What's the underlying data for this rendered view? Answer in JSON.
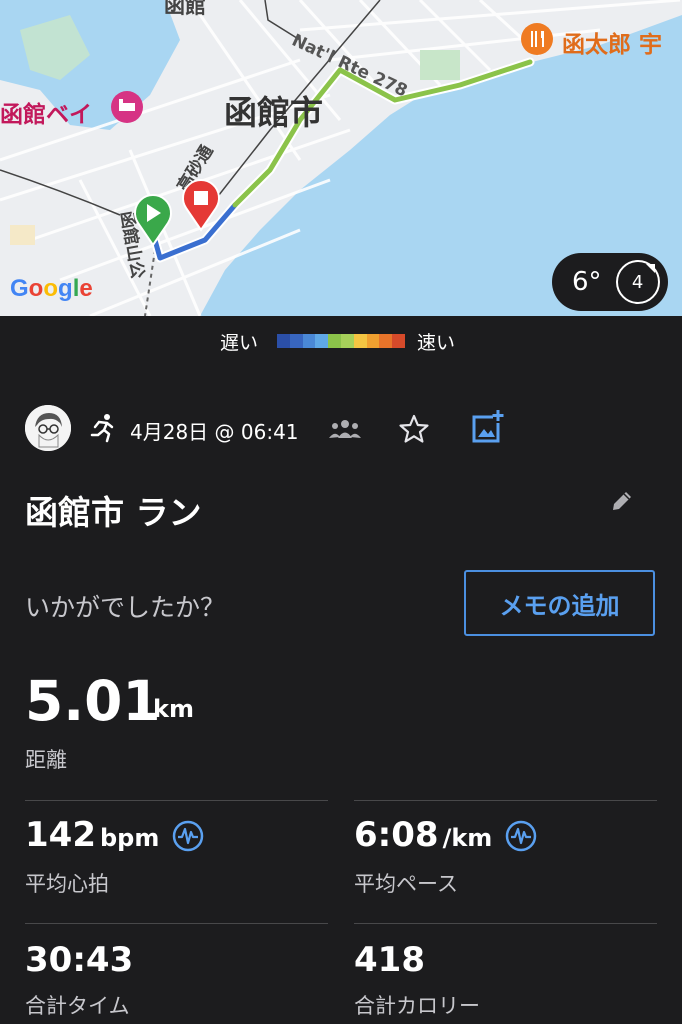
{
  "map": {
    "city_label": "函館市",
    "bay_label": "函館ベイ",
    "restaurant_label": "函太郎 宇",
    "top_label": "函館",
    "street_label_a": "高砂通",
    "street_label_b": "函館山公",
    "route_label": "Nat'l Rte 278",
    "google_letters": [
      "G",
      "o",
      "o",
      "g",
      "l",
      "e"
    ],
    "weather_temp": "6°",
    "wind_speed": "4"
  },
  "legend": {
    "slow_label": "遅い",
    "fast_label": "速い",
    "colors": [
      "#2b4fa8",
      "#3866c0",
      "#4a88d6",
      "#5fa8e6",
      "#8bc34a",
      "#a6d05a",
      "#f4c542",
      "#f0a030",
      "#e8742a",
      "#d64a2a"
    ]
  },
  "header": {
    "date_text": "4月28日 @ 06:41"
  },
  "activity": {
    "title": "函館市 ラン",
    "feeling_prompt": "いかがでしたか？",
    "memo_button": "メモの追加"
  },
  "distance": {
    "value": "5.01",
    "unit": "km",
    "label": "距離"
  },
  "stats": [
    {
      "value": "142",
      "unit": "bpm",
      "label": "平均心拍",
      "has_icon": true
    },
    {
      "value": "6:08",
      "unit": "/km",
      "label": "平均ペース",
      "has_icon": true
    },
    {
      "value": "30:43",
      "unit": "",
      "label": "合計タイム",
      "has_icon": false
    },
    {
      "value": "418",
      "unit": "",
      "label": "合計カロリー",
      "has_icon": false
    }
  ],
  "colors": {
    "background": "#1c1c1e",
    "accent": "#5aa0f0",
    "secondary_text": "#c7c7cc",
    "water": "#a8d8f0"
  }
}
